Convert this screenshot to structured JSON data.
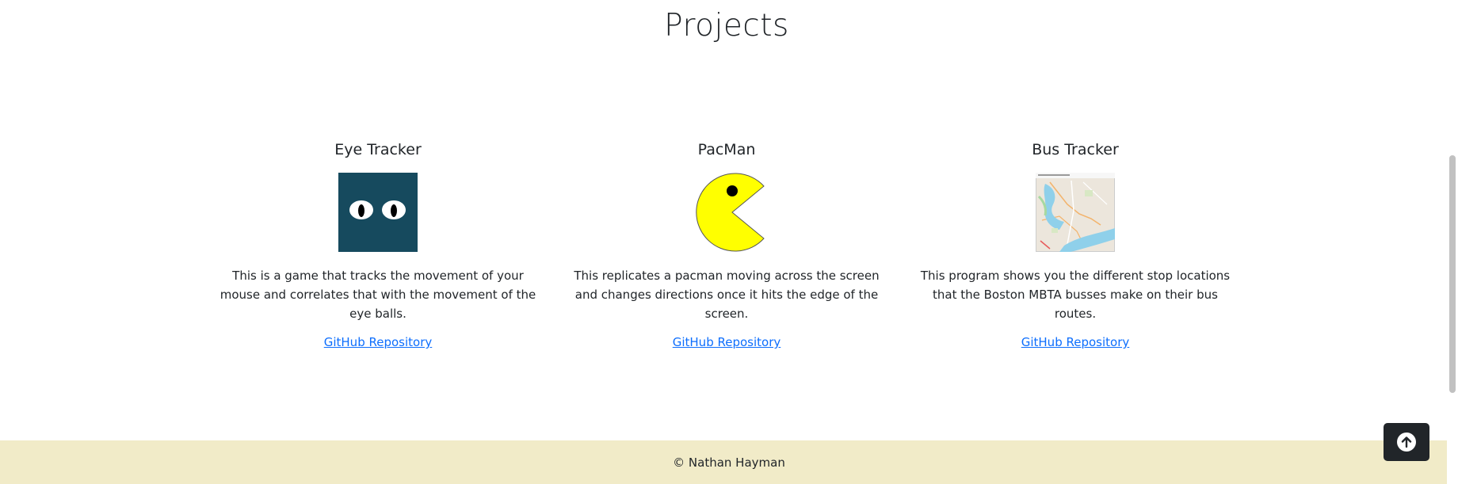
{
  "section": {
    "title": "Projects"
  },
  "projects": [
    {
      "title": "Eye Tracker",
      "image_icon": "eyes-icon",
      "description": "This is a game that tracks the movement of your mouse and correlates that with the movement of the eye balls.",
      "link_label": "GitHub Repository"
    },
    {
      "title": "PacMan",
      "image_icon": "pacman-icon",
      "description": "This replicates a pacman moving across the screen and changes directions once it hits the edge of the screen.",
      "link_label": "GitHub Repository"
    },
    {
      "title": "Bus Tracker",
      "image_icon": "map-icon",
      "description": "This program shows you the different stop locations that the Boston MBTA busses make on their bus routes.",
      "link_label": "GitHub Repository"
    }
  ],
  "footer": {
    "text": "© Nathan Hayman"
  },
  "back_to_top": {
    "icon": "arrow-up-circle-icon"
  },
  "colors": {
    "eye_tracker_bg": "#164a5e",
    "pacman_yellow": "#ffff00",
    "footer_bg": "#f1ebc8",
    "link": "#0d6efd",
    "button_bg": "#212529"
  }
}
